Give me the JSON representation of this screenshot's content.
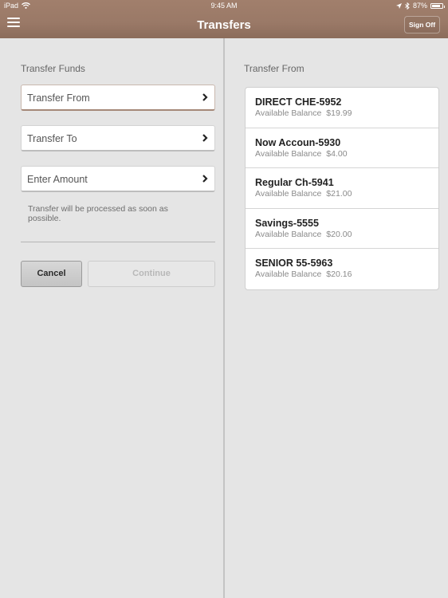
{
  "status_bar": {
    "device": "iPad",
    "time": "9:45 AM",
    "battery_text": "87%",
    "battery_level": 0.87,
    "icons": [
      "wifi-icon",
      "location-arrow-icon",
      "bluetooth-icon",
      "battery-icon"
    ]
  },
  "header": {
    "title": "Transfers",
    "menu_icon": "hamburger-menu-icon",
    "sign_off_label": "Sign Off",
    "brand_color": "#9b7a68"
  },
  "left_pane": {
    "section_label": "Transfer Funds",
    "fields": [
      {
        "label": "Transfer From",
        "icon": "chevron-right-icon",
        "active": true
      },
      {
        "label": "Transfer To",
        "icon": "chevron-right-icon",
        "active": false
      },
      {
        "label": "Enter Amount",
        "icon": "chevron-right-icon",
        "active": false
      }
    ],
    "note": "Transfer will be processed as soon as possible.",
    "cancel_label": "Cancel",
    "continue_label": "Continue",
    "continue_enabled": false
  },
  "right_pane": {
    "section_label": "Transfer From",
    "balance_label": "Available Balance",
    "accounts": [
      {
        "name": "DIRECT CHE-5952",
        "balance": "$19.99"
      },
      {
        "name": "Now Accoun-5930",
        "balance": "$4.00"
      },
      {
        "name": "Regular Ch-5941",
        "balance": "$21.00"
      },
      {
        "name": "Savings-5555",
        "balance": "$20.00"
      },
      {
        "name": "SENIOR 55-5963",
        "balance": "$20.16"
      }
    ]
  }
}
